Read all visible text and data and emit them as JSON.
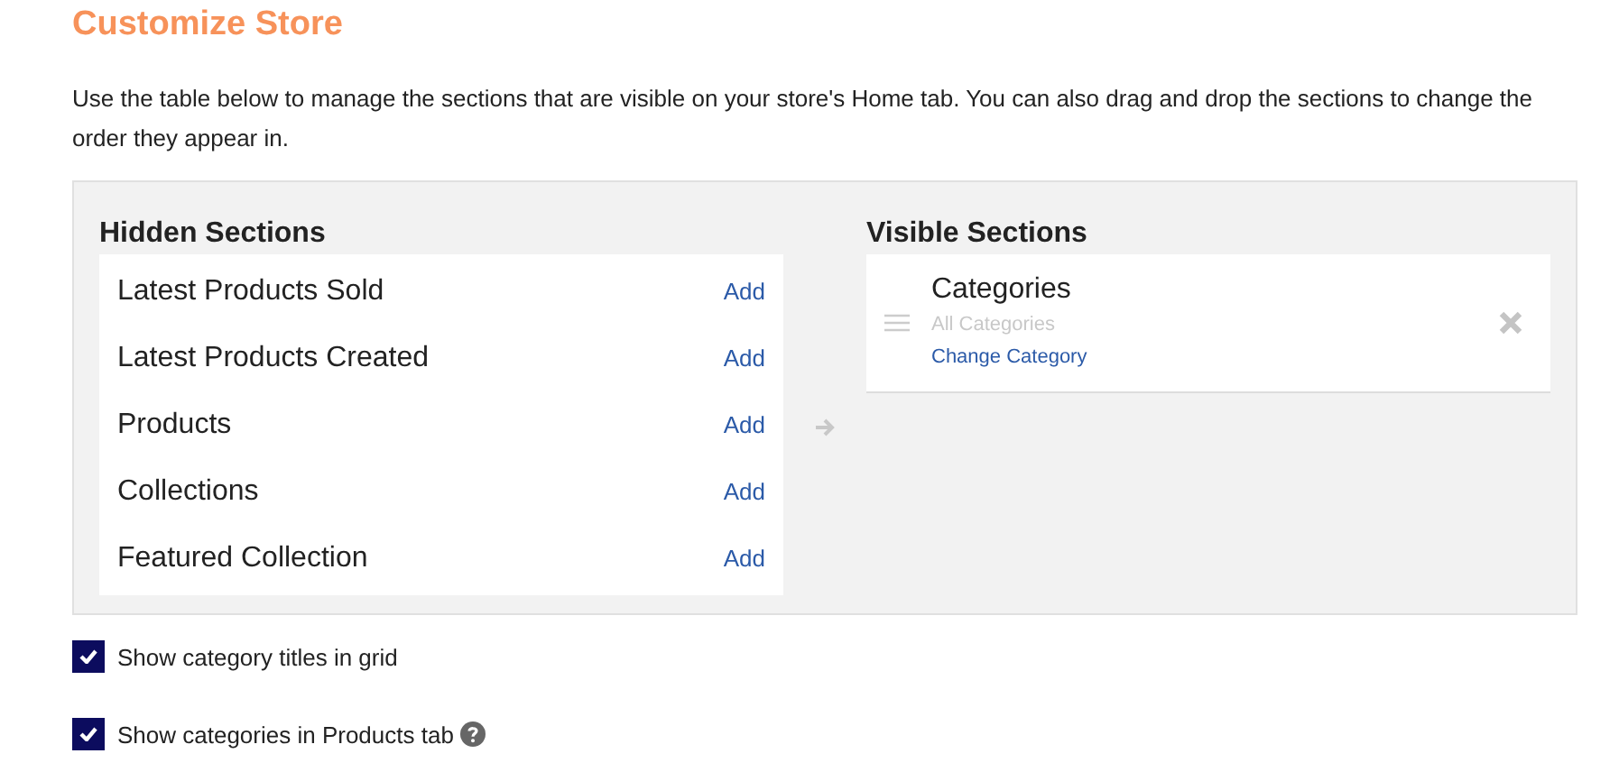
{
  "title": "Customize Store",
  "description": "Use the table below to manage the sections that are visible on your store's Home tab. You can also drag and drop the sections to change the order they appear in.",
  "hidden_sections": {
    "heading": "Hidden Sections",
    "items": [
      {
        "name": "Latest Products Sold",
        "action": "Add"
      },
      {
        "name": "Latest Products Created",
        "action": "Add"
      },
      {
        "name": "Products",
        "action": "Add"
      },
      {
        "name": "Collections",
        "action": "Add"
      },
      {
        "name": "Featured Collection",
        "action": "Add"
      }
    ]
  },
  "visible_sections": {
    "heading": "Visible Sections",
    "items": [
      {
        "name": "Categories",
        "subtitle": "All Categories",
        "link": "Change Category"
      }
    ]
  },
  "options": [
    {
      "label": "Show category titles in grid",
      "checked": true,
      "help": false
    },
    {
      "label": "Show categories in Products tab",
      "checked": true,
      "help": true
    }
  ]
}
